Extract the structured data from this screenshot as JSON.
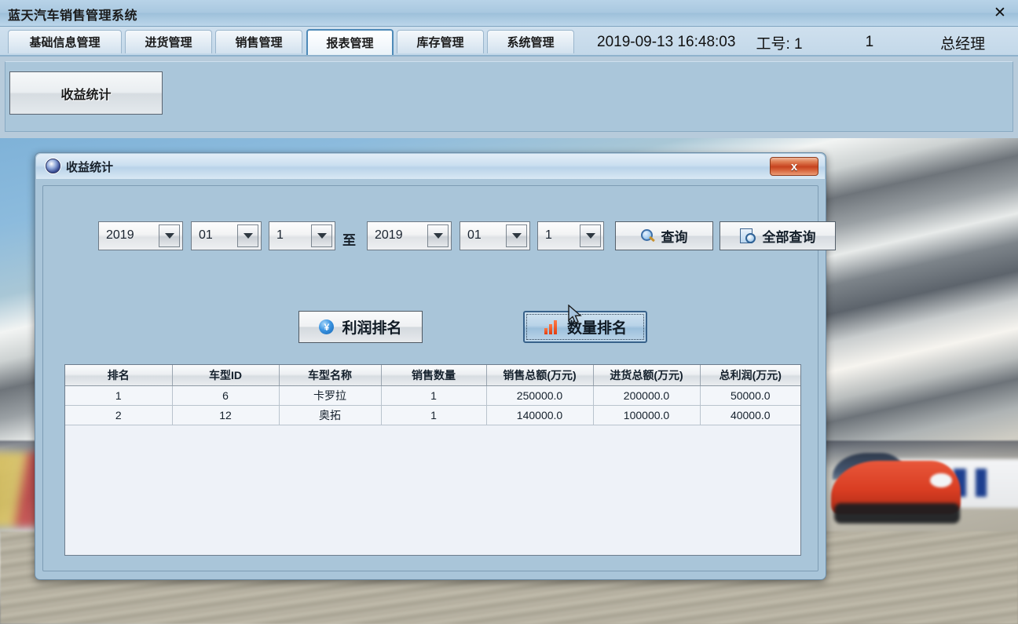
{
  "window": {
    "title": "蓝天汽车销售管理系统",
    "close_label": "✕"
  },
  "tabs": [
    {
      "label": "基础信息管理",
      "active": false
    },
    {
      "label": "进货管理",
      "active": false
    },
    {
      "label": "销售管理",
      "active": false
    },
    {
      "label": "报表管理",
      "active": true
    },
    {
      "label": "库存管理",
      "active": false
    },
    {
      "label": "系统管理",
      "active": false
    }
  ],
  "header": {
    "datetime": "2019-09-13 16:48:03",
    "emp_label": "工号: 1",
    "emp_id": "1",
    "role": "总经理"
  },
  "toolbar": {
    "income_stat_label": "收益统计"
  },
  "dialog": {
    "title": "收益统计",
    "icon": "gear-icon",
    "close_label": "x",
    "filter": {
      "start_year": "2019",
      "start_month": "01",
      "start_day": "1",
      "separator": "至",
      "end_year": "2019",
      "end_month": "01",
      "end_day": "1",
      "query_label": "查询",
      "query_all_label": "全部查询"
    },
    "rank_buttons": {
      "profit_label": "利润排名",
      "profit_icon": "yen-coin-icon",
      "quantity_label": "数量排名",
      "quantity_icon": "bar-chart-icon",
      "quantity_selected": true
    },
    "table": {
      "columns": [
        "排名",
        "车型ID",
        "车型名称",
        "销售数量",
        "销售总额(万元)",
        "进货总额(万元)",
        "总利润(万元)"
      ],
      "rows": [
        [
          "1",
          "6",
          "卡罗拉",
          "1",
          "250000.0",
          "200000.0",
          "50000.0"
        ],
        [
          "2",
          "12",
          "奥拓",
          "1",
          "140000.0",
          "100000.0",
          "40000.0"
        ]
      ]
    }
  },
  "colors": {
    "window_chrome": "#b8d3e8",
    "dialog_face": "#a9c5d9",
    "active_tab_border": "#4e8ab8",
    "close_red": "#c6431f",
    "table_row": "#f3f6fa"
  }
}
